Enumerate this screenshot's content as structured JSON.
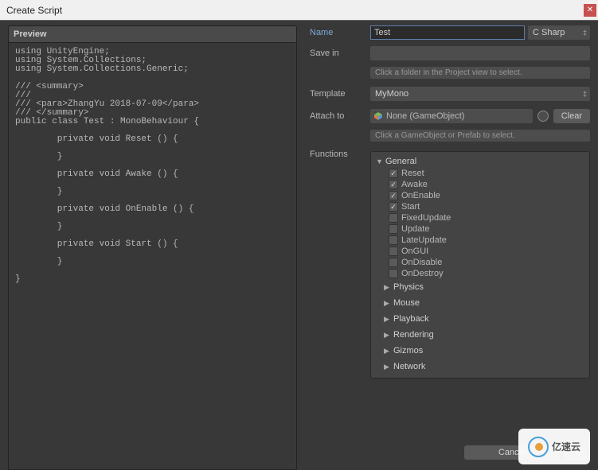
{
  "window": {
    "title": "Create Script"
  },
  "preview": {
    "label": "Preview",
    "code": "using UnityEngine;\nusing System.Collections;\nusing System.Collections.Generic;\n\n/// <summary>\n///\n/// <para>ZhangYu 2018-07-09</para>\n/// </summary>\npublic class Test : MonoBehaviour {\n\n        private void Reset () {\n\n        }\n\n        private void Awake () {\n\n        }\n\n        private void OnEnable () {\n\n        }\n\n        private void Start () {\n\n        }\n\n}"
  },
  "form": {
    "name_label": "Name",
    "name_value": "Test",
    "language": "C Sharp",
    "savein_label": "Save in",
    "savein_hint": "Click a folder in the Project view to select.",
    "template_label": "Template",
    "template_value": "MyMono",
    "attach_label": "Attach to",
    "attach_value": "None (GameObject)",
    "attach_hint": "Click a GameObject or Prefab to select.",
    "clear_label": "Clear",
    "functions_label": "Functions"
  },
  "functions": {
    "general": {
      "label": "General",
      "items": [
        {
          "name": "Reset",
          "checked": true
        },
        {
          "name": "Awake",
          "checked": true
        },
        {
          "name": "OnEnable",
          "checked": true
        },
        {
          "name": "Start",
          "checked": true
        },
        {
          "name": "FixedUpdate",
          "checked": false
        },
        {
          "name": "Update",
          "checked": false
        },
        {
          "name": "LateUpdate",
          "checked": false
        },
        {
          "name": "OnGUI",
          "checked": false
        },
        {
          "name": "OnDisable",
          "checked": false
        },
        {
          "name": "OnDestroy",
          "checked": false
        }
      ]
    },
    "groups": [
      "Physics",
      "Mouse",
      "Playback",
      "Rendering",
      "Gizmos",
      "Network"
    ]
  },
  "buttons": {
    "cancel": "Cancel",
    "create": ""
  },
  "watermark": "亿速云"
}
